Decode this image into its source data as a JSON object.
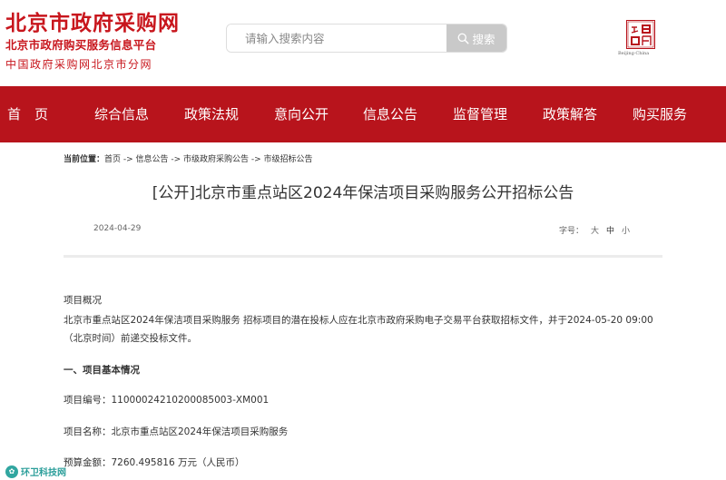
{
  "header": {
    "logo_title": "北京市政府采购网",
    "logo_subtitle": "北京市政府购买服务信息平台",
    "logo_subtitle2": "中国政府采购网北京市分网",
    "search_placeholder": "请输入搜索内容",
    "search_button": "搜索",
    "seal_caption": "Beijing·China"
  },
  "nav": {
    "items": [
      "首　页",
      "综合信息",
      "政策法规",
      "意向公开",
      "信息公告",
      "监督管理",
      "政策解答",
      "购买服务"
    ]
  },
  "breadcrumb": {
    "label": "当前位置：",
    "path": "首页 -> 信息公告 -> 市级政府采购公告 -> 市级招标公告"
  },
  "article": {
    "title": "[公开]北京市重点站区2024年保洁项目采购服务公开招标公告",
    "date": "2024-04-29",
    "font_size_label": "字号：",
    "font_large": "大",
    "font_medium": "中",
    "font_small": "小",
    "overview_heading": "项目概况",
    "overview_text": "北京市重点站区2024年保洁项目采购服务 招标项目的潜在投标人应在北京市政府采购电子交易平台获取招标文件，并于2024-05-20 09:00（北京时间）前递交投标文件。",
    "section1_heading": "一、项目基本情况",
    "project_number": "项目编号：11000024210200085003-XM001",
    "project_name": "项目名称：北京市重点站区2024年保洁项目采购服务",
    "budget": "预算金额：7260.495816 万元（人民币）"
  },
  "watermark": {
    "text": "环卫科技网"
  },
  "colors": {
    "brand_red": "#c8161d",
    "nav_red": "#b8141c",
    "search_button_gray": "#c9c9c9",
    "watermark_teal": "#2b9e9a"
  },
  "icons": {
    "search": "search-icon",
    "seal": "capital-seal-icon",
    "watermark": "watermark-logo-icon"
  }
}
